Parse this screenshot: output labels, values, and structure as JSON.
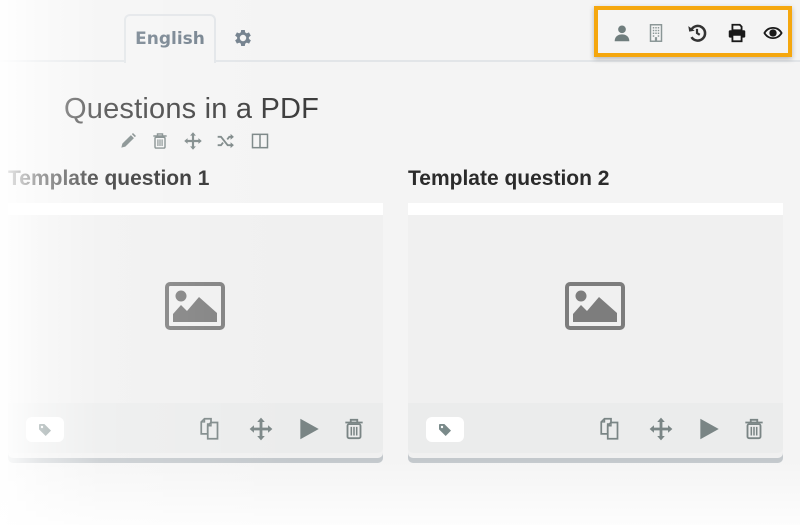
{
  "header": {
    "language_tab": "English",
    "settings_icon": "gear-icon",
    "toolbox": {
      "highlight_color": "#f5a70e",
      "icons": [
        "user-icon",
        "building-icon",
        "history-icon",
        "print-icon",
        "eye-icon"
      ]
    }
  },
  "questionnaire": {
    "title": "Questions in a PDF",
    "tools": [
      "pencil-icon",
      "trash-icon",
      "move-icon",
      "shuffle-icon",
      "columns-icon"
    ]
  },
  "cards": [
    {
      "title": "Template question 1",
      "image_icon": "image-icon",
      "tag_icon": "tag-icon",
      "actions": [
        "duplicate-icon",
        "move-icon",
        "play-icon",
        "trash-icon"
      ]
    },
    {
      "title": "Template question 2",
      "image_icon": "image-icon",
      "tag_icon": "tag-icon",
      "actions": [
        "duplicate-icon",
        "move-icon",
        "play-icon",
        "trash-icon"
      ]
    }
  ],
  "colors": {
    "icon_gray": "#7a8a8a",
    "text_dark": "#2b2b2b",
    "tab_text": "#6f7d8a",
    "accent_orange": "#f5a70e"
  }
}
